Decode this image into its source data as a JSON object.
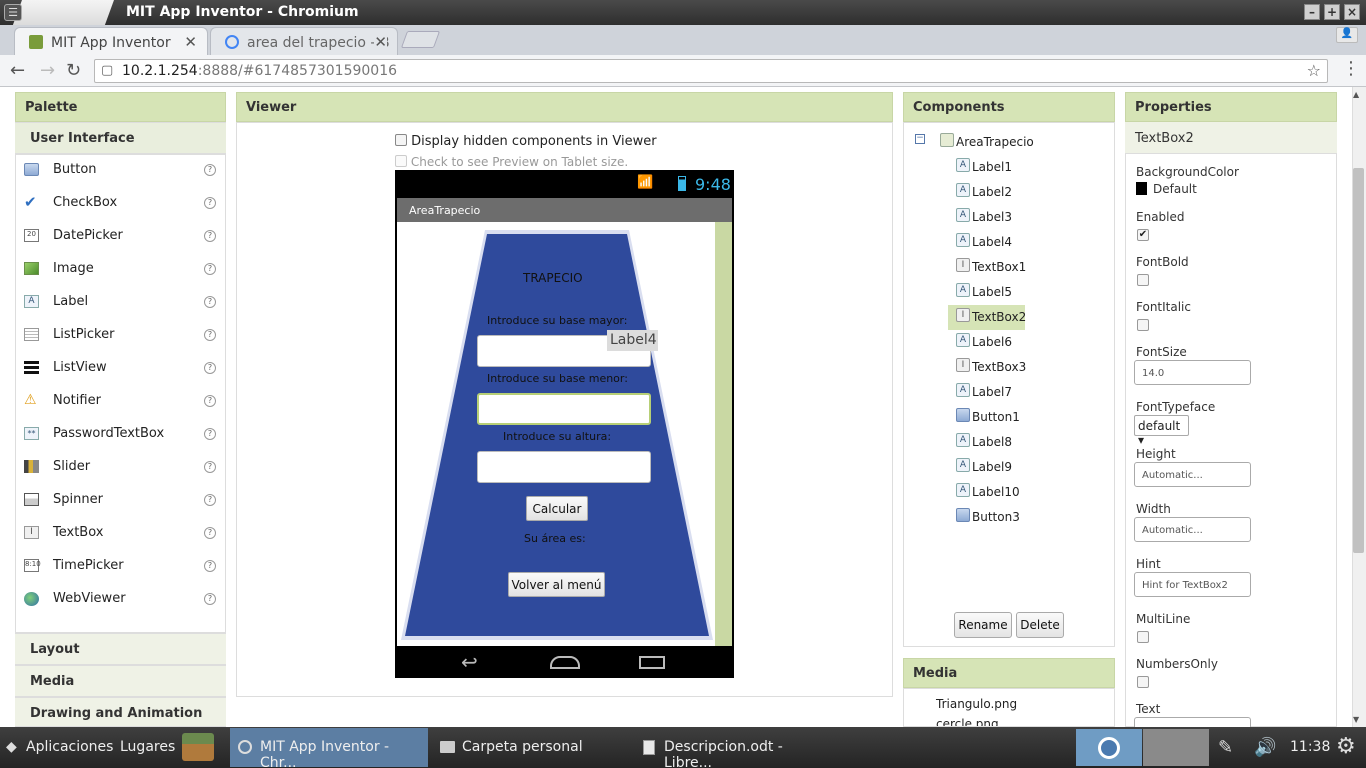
{
  "window": {
    "title": "MIT App Inventor - Chromium"
  },
  "tabs": [
    {
      "label": "MIT App Inventor",
      "active": true
    },
    {
      "label": "area del trapecio - B",
      "active": false
    }
  ],
  "address": {
    "host": "10.2.1.254",
    "rest": ":8888/#6174857301590016"
  },
  "palette": {
    "title": "Palette",
    "category_open": "User Interface",
    "items": [
      "Button",
      "CheckBox",
      "DatePicker",
      "Image",
      "Label",
      "ListPicker",
      "ListView",
      "Notifier",
      "PasswordTextBox",
      "Slider",
      "Spinner",
      "TextBox",
      "TimePicker",
      "WebViewer"
    ],
    "help": "?",
    "categories_closed": [
      "Layout",
      "Media",
      "Drawing and Animation"
    ]
  },
  "viewer": {
    "title": "Viewer",
    "display_hidden": "Display hidden components in Viewer",
    "tablet_preview": "Check to see Preview on Tablet size.",
    "phone": {
      "time": "9:48",
      "app_title": "AreaTrapecio",
      "heading": "TRAPECIO",
      "label_base_mayor": "Introduce su base mayor:",
      "hover_label": "Label4",
      "label_base_menor": "Introduce su base menor:",
      "label_altura": "Introduce su altura:",
      "calc_button": "Calcular",
      "area_label": "Su área es:",
      "back_button": "Volver al menú"
    }
  },
  "components": {
    "title": "Components",
    "root": "AreaTrapecio",
    "items": [
      {
        "name": "Label1",
        "type": "label"
      },
      {
        "name": "Label2",
        "type": "label"
      },
      {
        "name": "Label3",
        "type": "label"
      },
      {
        "name": "Label4",
        "type": "label"
      },
      {
        "name": "TextBox1",
        "type": "textbox"
      },
      {
        "name": "Label5",
        "type": "label"
      },
      {
        "name": "TextBox2",
        "type": "textbox",
        "selected": true
      },
      {
        "name": "Label6",
        "type": "label"
      },
      {
        "name": "TextBox3",
        "type": "textbox"
      },
      {
        "name": "Label7",
        "type": "label"
      },
      {
        "name": "Button1",
        "type": "button"
      },
      {
        "name": "Label8",
        "type": "label"
      },
      {
        "name": "Label9",
        "type": "label"
      },
      {
        "name": "Label10",
        "type": "label"
      },
      {
        "name": "Button3",
        "type": "button"
      }
    ],
    "rename": "Rename",
    "delete": "Delete"
  },
  "media": {
    "title": "Media",
    "files": [
      "Triangulo.png",
      "cercle.png"
    ]
  },
  "properties": {
    "title": "Properties",
    "component": "TextBox2",
    "background_color_label": "BackgroundColor",
    "background_color_value": "Default",
    "enabled_label": "Enabled",
    "enabled": true,
    "fontbold_label": "FontBold",
    "fontitalic_label": "FontItalic",
    "fontsize_label": "FontSize",
    "fontsize_value": "14.0",
    "fonttypeface_label": "FontTypeface",
    "fonttypeface_value": "default ▾",
    "height_label": "Height",
    "height_value": "Automatic...",
    "width_label": "Width",
    "width_value": "Automatic...",
    "hint_label": "Hint",
    "hint_value": "Hint for TextBox2",
    "multiline_label": "MultiLine",
    "numbersonly_label": "NumbersOnly",
    "text_label": "Text"
  },
  "taskbar": {
    "apps_menu": "Aplicaciones",
    "places_menu": "Lugares",
    "tasks": [
      "MIT App Inventor - Chr...",
      "Carpeta personal",
      "Descripcion.odt - Libre..."
    ],
    "clock": "11:38"
  },
  "colors": {
    "panel_header": "#d6e4b6",
    "selected": "#d6e4b6",
    "trapezoid": "#2f4a9c",
    "task_active": "#5c7ea3"
  }
}
